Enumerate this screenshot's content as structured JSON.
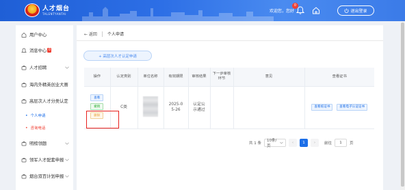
{
  "header": {
    "logo_main": "人才烟台",
    "logo_sub": "TALENTYANTAI",
    "greeting": "欢迎您，您好",
    "notification_count": "0",
    "logout_label": "退出登录"
  },
  "sidebar": {
    "items": [
      {
        "label": "用户中心"
      },
      {
        "label": "消息中心",
        "badge": "0"
      },
      {
        "label": "人才招聘"
      },
      {
        "label": "海内外精英创业大赛"
      },
      {
        "label": "高层次人才分类认定"
      },
      {
        "label": "明榜领题"
      },
      {
        "label": "领军人才配套申报"
      },
      {
        "label": "烟台双百计划申报"
      }
    ],
    "sub_items": [
      {
        "label": "个人申请"
      },
      {
        "label": "咨询电话"
      }
    ]
  },
  "main": {
    "back_label": "← 返回",
    "page_title": "个人申请",
    "add_button": "+ 高层次人才认定申请",
    "table": {
      "columns": [
        "操作",
        "认定类别",
        "单位名称",
        "有效期限",
        "审核结果",
        "下一步审核环节",
        "意见",
        "查看证书"
      ],
      "row": {
        "actions": [
          "查看",
          "撤销",
          "删除"
        ],
        "category": "C类",
        "validity": "2025-05-26",
        "result": "认定公示通过",
        "next_step": "",
        "opinion": "",
        "certificates": [
          "查看纸证书",
          "查看电子认证证书"
        ]
      }
    },
    "pagination": {
      "total": "共 1 条",
      "page_size": "10条/页",
      "current_page": "1",
      "goto_label": "前往",
      "goto_value": "1",
      "page_suffix": "页"
    }
  },
  "colors": {
    "header_blue": "#2d6fe6",
    "accent_blue": "#1d6fe8",
    "danger_red": "#f04134",
    "highlight_box": "#e8201c"
  }
}
